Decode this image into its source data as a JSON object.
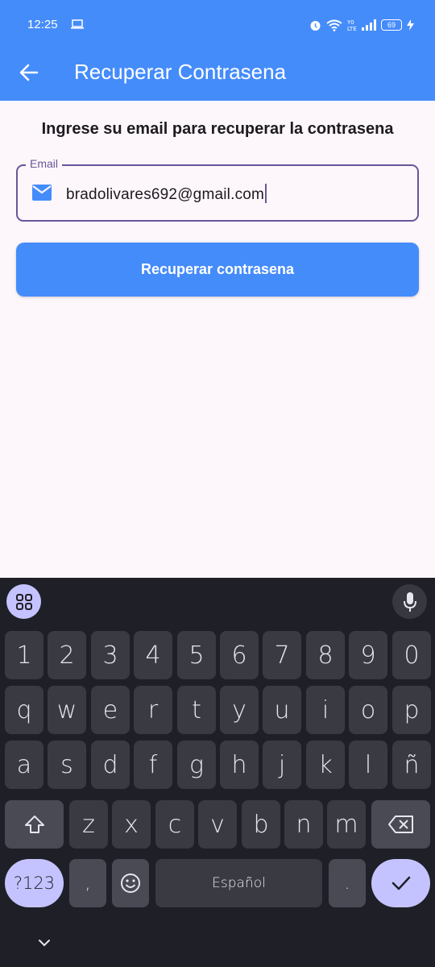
{
  "status_bar": {
    "time": "12:25",
    "battery": "69",
    "icons": [
      "laptop-icon",
      "alarm-icon",
      "wifi-icon",
      "volte-icon",
      "signal-icon",
      "battery-icon",
      "charging-icon"
    ]
  },
  "app_bar": {
    "title": "Recuperar Contrasena",
    "back_icon": "arrow-back-icon",
    "color": "#458cfb"
  },
  "form": {
    "instruction": "Ingrese su email para recuperar la contrasena",
    "email_label": "Email",
    "email_value": "bradolivares692@gmail.com",
    "email_icon": "mail-icon",
    "submit_label": "Recuperar contrasena"
  },
  "keyboard": {
    "language": "Español",
    "rows": [
      [
        "1",
        "2",
        "3",
        "4",
        "5",
        "6",
        "7",
        "8",
        "9",
        "0"
      ],
      [
        "q",
        "w",
        "e",
        "r",
        "t",
        "y",
        "u",
        "i",
        "o",
        "p"
      ],
      [
        "a",
        "s",
        "d",
        "f",
        "g",
        "h",
        "j",
        "k",
        "l",
        "ñ"
      ],
      [
        "z",
        "x",
        "c",
        "v",
        "b",
        "n",
        "m"
      ]
    ],
    "symbols_label": "?123",
    "comma": ",",
    "period": "."
  }
}
